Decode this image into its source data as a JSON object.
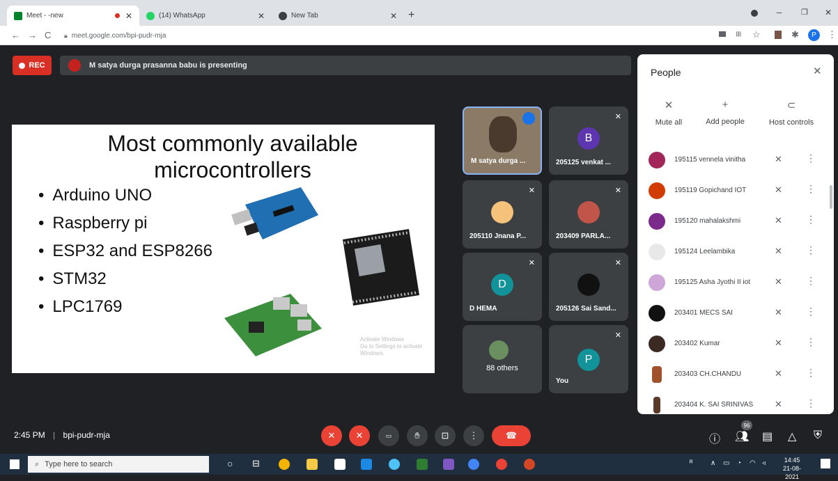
{
  "browser": {
    "tabs": [
      {
        "label": "Meet - -new",
        "active": true
      },
      {
        "label": "(14) WhatsApp",
        "active": false
      },
      {
        "label": "New Tab",
        "active": false
      }
    ],
    "url": "meet.google.com/bpi-pudr-mja"
  },
  "meet": {
    "rec_label": "REC",
    "presenting_text": "M satya durga prasanna babu is presenting",
    "slide": {
      "title_line1": "Most commonly available",
      "title_line2": "microcontrollers",
      "bullets": [
        "Arduino UNO",
        "Raspberry pi",
        "ESP32 and ESP8266",
        "STM32",
        "LPC1769"
      ],
      "watermark_line1": "Activate Windows",
      "watermark_line2": "Go to Settings to activate Windows."
    },
    "tiles": [
      {
        "name": "M satya durga ...",
        "initial": ""
      },
      {
        "name": "205125 venkat ...",
        "initial": "B",
        "color": "#5e35b1"
      },
      {
        "name": "205110 Jnana P...",
        "initial": ""
      },
      {
        "name": "203409 PARLA...",
        "initial": ""
      },
      {
        "name": "D HEMA",
        "initial": "D",
        "color": "#12939a"
      },
      {
        "name": "205126 Sai Sand...",
        "initial": ""
      },
      {
        "name": "88 others",
        "initial": ""
      },
      {
        "name": "You",
        "initial": "P",
        "color": "#12939a"
      }
    ],
    "people_panel": {
      "title": "People",
      "actions": [
        "Mute all",
        "Add people",
        "Host controls"
      ],
      "participants": [
        {
          "name": "195115 vennela vinitha",
          "color": "#a3265a"
        },
        {
          "name": "195119 Gopichand IOT",
          "color": "#d23c00"
        },
        {
          "name": "195120 mahalakshmi",
          "color": "#7b2a8c"
        },
        {
          "name": "195124 Leelambika",
          "color": "#e8e8e8"
        },
        {
          "name": "195125 Asha Jyothi II iot",
          "color": "#cfa6d8"
        },
        {
          "name": "203401 MECS SAI",
          "color": "#111111"
        },
        {
          "name": "203402 Kumar",
          "color": "#3a2a22"
        },
        {
          "name": "203403 CH.CHANDU",
          "color": "#a0522d"
        },
        {
          "name": "203404 K. SAI SRINIVAS",
          "color": "#5a3a2a"
        }
      ]
    },
    "time": "2:45 PM",
    "meeting_code": "bpi-pudr-mja",
    "participant_count": "96"
  },
  "taskbar": {
    "search_placeholder": "Type here to search",
    "clock_time": "14:45",
    "clock_date": "21-08-2021"
  }
}
